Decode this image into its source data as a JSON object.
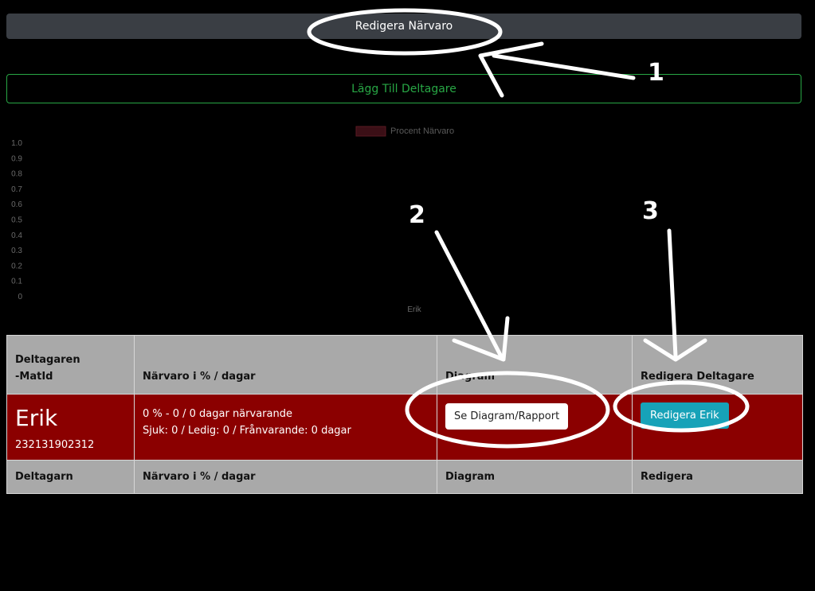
{
  "header": {
    "edit_attendance_label": "Redigera Närvaro"
  },
  "add_participant_label": "Lägg Till Deltagare",
  "chart_data": {
    "type": "bar",
    "categories": [
      "Erik"
    ],
    "series": [
      {
        "name": "Procent Närvaro",
        "values": [
          0
        ],
        "color": "#3b0f16"
      }
    ],
    "yticks": [
      "1.0",
      "0.9",
      "0.8",
      "0.7",
      "0.6",
      "0.5",
      "0.4",
      "0.3",
      "0.2",
      "0.1",
      "0"
    ],
    "ylim": [
      0,
      1
    ],
    "legend_placement": "top"
  },
  "table": {
    "header": {
      "participant_line1": "Deltagaren",
      "participant_line2": "-MatId",
      "attendance": "Närvaro i % / dagar",
      "diagram": "Diagram",
      "edit": "Redigera Deltagare"
    },
    "row": {
      "name": "Erik",
      "matid": "232131902312",
      "attendance_line1": "0 % - 0 / 0 dagar närvarande",
      "attendance_line2": "Sjuk: 0 / Ledig: 0 / Frånvarande: 0 dagar",
      "diagram_button": "Se Diagram/Rapport",
      "edit_button": "Redigera Erik"
    },
    "footer": {
      "participant": "Deltagarn",
      "attendance": "Närvaro i % / dagar",
      "diagram": "Diagram",
      "edit": "Redigera"
    }
  },
  "annotations": [
    "1",
    "2",
    "3"
  ]
}
